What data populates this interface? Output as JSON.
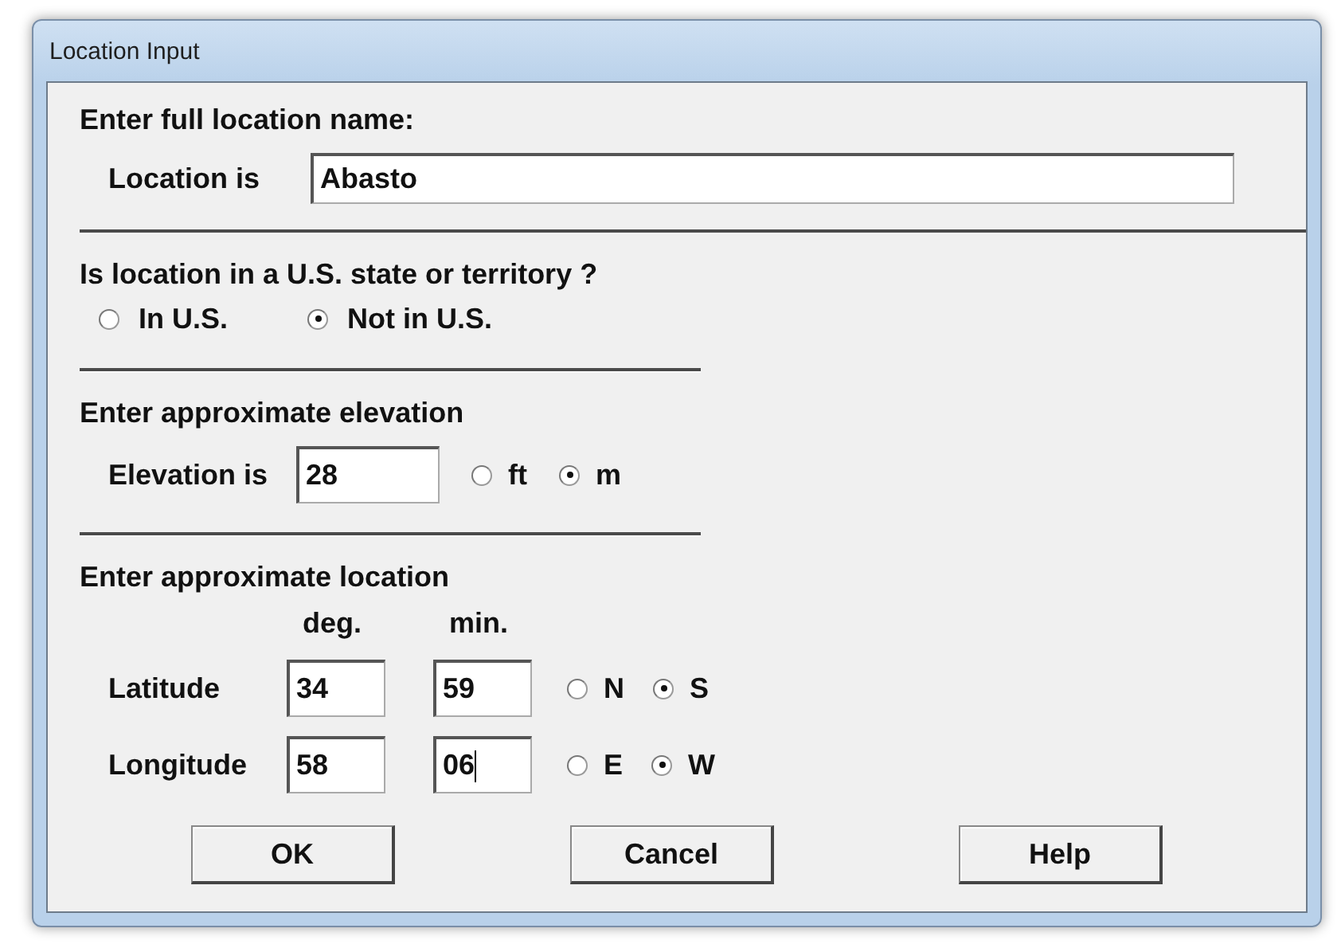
{
  "window": {
    "title": "Location Input"
  },
  "name_section": {
    "heading": "Enter full location name:",
    "label": "Location is",
    "value": "Abasto"
  },
  "us_section": {
    "question": "Is location in a U.S. state or territory ?",
    "options": [
      {
        "label": "In U.S.",
        "selected": false
      },
      {
        "label": "Not in U.S.",
        "selected": true
      }
    ]
  },
  "elevation": {
    "heading": "Enter approximate elevation",
    "label": "Elevation is",
    "value": "28",
    "units": [
      {
        "label": "ft",
        "selected": false
      },
      {
        "label": "m",
        "selected": true
      }
    ]
  },
  "location": {
    "heading": "Enter approximate location",
    "column_headers": [
      "deg.",
      "min."
    ],
    "rows": [
      {
        "label": "Latitude",
        "deg": "34",
        "min": "59",
        "focused": false,
        "directions": [
          {
            "label": "N",
            "selected": false
          },
          {
            "label": "S",
            "selected": true
          }
        ]
      },
      {
        "label": "Longitude",
        "deg": "58",
        "min": "06",
        "focused": true,
        "directions": [
          {
            "label": "E",
            "selected": false
          },
          {
            "label": "W",
            "selected": true
          }
        ]
      }
    ]
  },
  "buttons": [
    "OK",
    "Cancel",
    "Help"
  ]
}
